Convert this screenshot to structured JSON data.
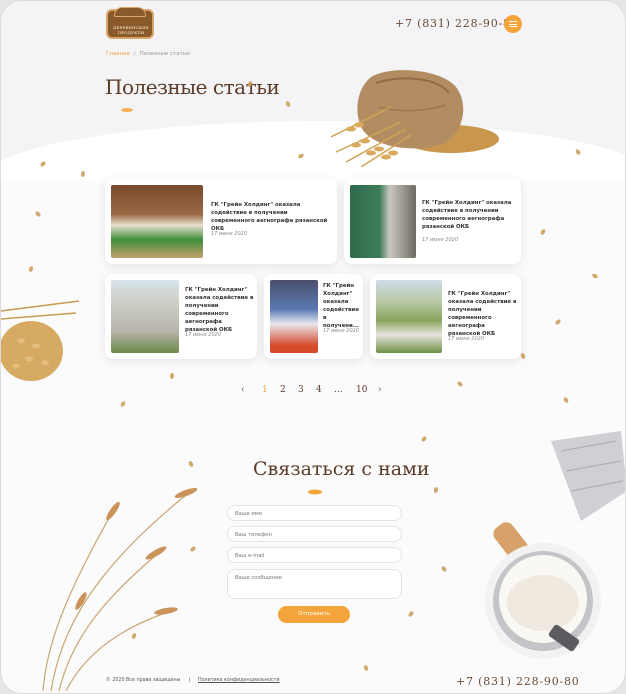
{
  "header": {
    "logo_text": "ДЕРЕВЕНСКИЕ ПРОДУКТЫ",
    "phone": "+7 (831) 228-90-80",
    "menu_icon": "hamburger-icon"
  },
  "breadcrumbs": [
    {
      "label": "Главная"
    },
    {
      "label": "Полезные статьи"
    }
  ],
  "breadcrumb_separator": "/",
  "page_title": "Полезные статьи",
  "articles": [
    {
      "title": "ГК \"Грейн Холдинг\" оказала содействие в получении современного аегнографа рязанской ОКБ",
      "date": "17 июня 2020"
    },
    {
      "title": "ГК \"Грейн Холдинг\" оказала содействие в получении современного аегнографа рязанской ОКБ",
      "date": "17 июня 2020"
    },
    {
      "title": "ГК \"Грейн Холдинг\" оказала содействие в получении современного аегнографа рязанской ОКБ",
      "date": "17 июня 2020"
    },
    {
      "title": "ГК \"Грейн Холдинг\" оказала содействие в получени...",
      "date": "17 июня 2020"
    },
    {
      "title": "ГК \"Грейн Холдинг\" оказала содействие в получении современного аегнографа рязанской ОКБ",
      "date": "17 июня 2020"
    }
  ],
  "pagination": {
    "prev_icon": "chevron-left-icon",
    "pages": [
      "1",
      "2",
      "3",
      "4",
      "...",
      "10"
    ],
    "current": "1",
    "next_icon": "chevron-right-icon"
  },
  "contact": {
    "title": "Связаться с нами",
    "name_placeholder": "Ваше имя",
    "phone_placeholder": "Ваш телефон",
    "email_placeholder": "Ваш e-mail",
    "message_placeholder": "Ваше сообщение",
    "submit_label": "Отправить"
  },
  "footer": {
    "copyright": "© 2020 Все права защищены",
    "separator": "|",
    "policy": "Политика конфиденциальности",
    "phone": "+7 (831) 228-90-80"
  },
  "colors": {
    "accent": "#f3a43b",
    "title_brown": "#5b3b27",
    "logo_brown": "#8b5a2b"
  }
}
